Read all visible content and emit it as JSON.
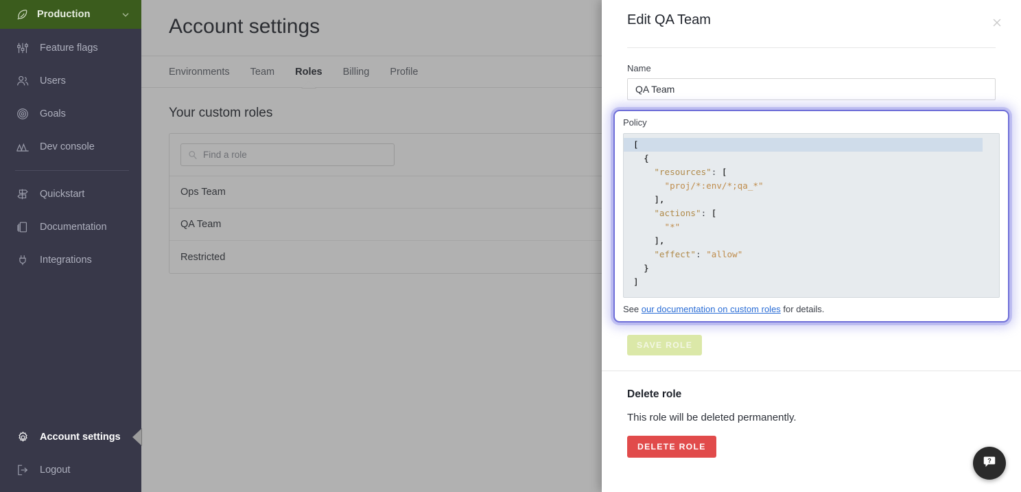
{
  "sidebar": {
    "environment": {
      "label": "Production",
      "icon": "feather-icon",
      "chevron": "chevron-down-icon"
    },
    "items": [
      {
        "label": "Feature flags",
        "icon": "sliders-icon"
      },
      {
        "label": "Users",
        "icon": "users-icon"
      },
      {
        "label": "Goals",
        "icon": "target-icon"
      },
      {
        "label": "Dev console",
        "icon": "chart-icon"
      }
    ],
    "items2": [
      {
        "label": "Quickstart",
        "icon": "signpost-icon"
      },
      {
        "label": "Documentation",
        "icon": "book-icon"
      },
      {
        "label": "Integrations",
        "icon": "plug-icon"
      }
    ],
    "bottom": [
      {
        "label": "Account settings",
        "icon": "gear-icon",
        "active": true
      },
      {
        "label": "Logout",
        "icon": "logout-icon",
        "active": false
      }
    ]
  },
  "main": {
    "page_title": "Account settings",
    "tabs": [
      {
        "label": "Environments",
        "active": false
      },
      {
        "label": "Team",
        "active": false
      },
      {
        "label": "Roles",
        "active": true
      },
      {
        "label": "Billing",
        "active": false
      },
      {
        "label": "Profile",
        "active": false
      }
    ],
    "section_title": "Your custom roles",
    "search": {
      "placeholder": "Find a role",
      "value": "",
      "icon": "search-icon"
    },
    "roles": [
      {
        "name": "Ops Team"
      },
      {
        "name": "QA Team"
      },
      {
        "name": "Restricted"
      }
    ]
  },
  "panel": {
    "title": "Edit QA Team",
    "close_icon": "close-icon",
    "name_label": "Name",
    "name_value": "QA Team",
    "policy_label": "Policy",
    "policy_lines": [
      {
        "text": "[",
        "active": true
      },
      {
        "text": "  {",
        "active": false
      },
      {
        "text": "    \"resources\": [",
        "active": false
      },
      {
        "text": "      \"proj/*:env/*;qa_*\"",
        "active": false
      },
      {
        "text": "    ],",
        "active": false
      },
      {
        "text": "    \"actions\": [",
        "active": false
      },
      {
        "text": "      \"*\"",
        "active": false
      },
      {
        "text": "    ],",
        "active": false
      },
      {
        "text": "    \"effect\": \"allow\"",
        "active": false
      },
      {
        "text": "  }",
        "active": false
      },
      {
        "text": "]",
        "active": false
      }
    ],
    "note_prefix": "See ",
    "note_link": "our documentation on custom roles",
    "note_suffix": " for details.",
    "save_label": "SAVE ROLE",
    "delete_title": "Delete role",
    "delete_desc": "This role will be deleted permanently.",
    "delete_label": "DELETE ROLE"
  },
  "help": {
    "icon": "help-chat-icon"
  },
  "colors": {
    "sidebar_bg": "#383849",
    "env_bg": "#3b5c1d",
    "focus_ring": "#6f6fd8",
    "delete_red": "#e14b4b",
    "save_green": "#dbe8a8",
    "link_blue": "#2a6dd6",
    "editor_bg": "#e7ebee",
    "active_line": "#cfdcea"
  }
}
